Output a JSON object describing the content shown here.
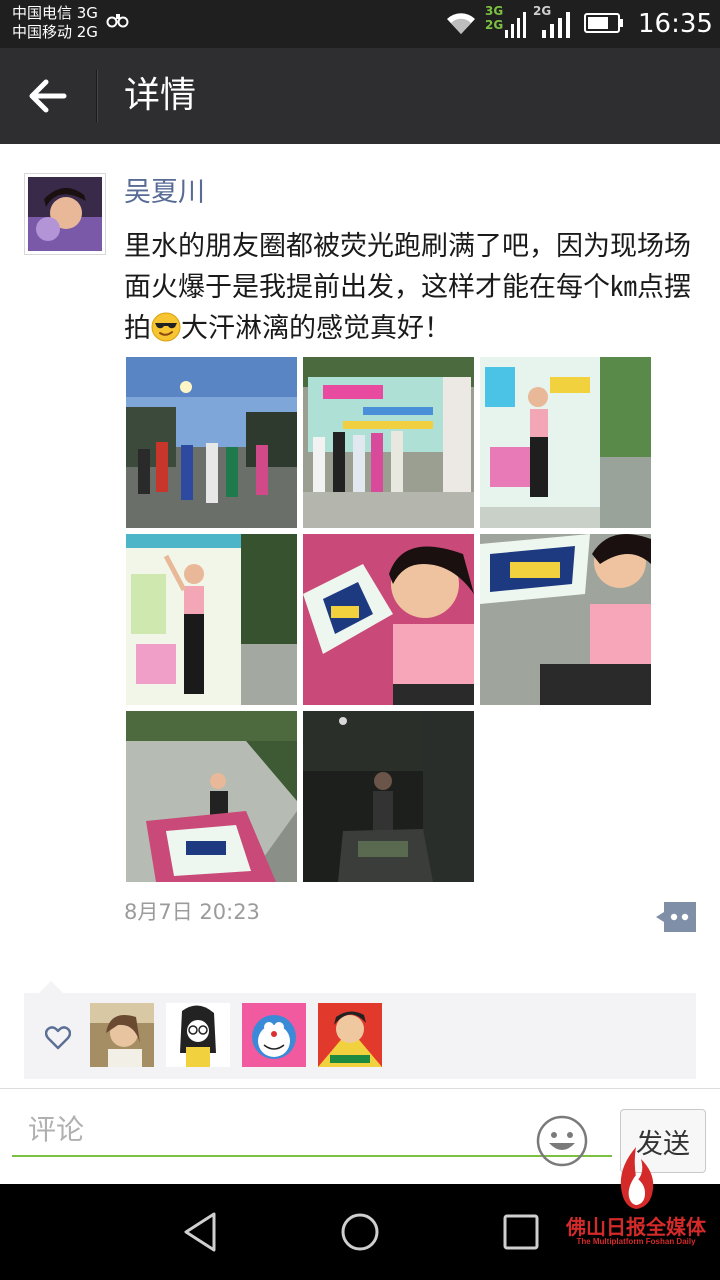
{
  "status_bar": {
    "carrier_1": "中国电信 3G",
    "carrier_2": "中国移动 2G",
    "network_1": "3G",
    "network_1b": "2G",
    "network_2": "2G",
    "time": "16:35",
    "icons": [
      "link-icon",
      "wifi-icon",
      "signal-icon",
      "battery-icon"
    ]
  },
  "title_bar": {
    "back_icon": "arrow-left-icon",
    "title": "详情"
  },
  "post": {
    "author": "吴夏川",
    "text_before_emoji": "里水的朋友圈都被荧光跑刷满了吧，因为现场场面火爆于是我提前出发，这样才能在每个㎞点摆拍",
    "emoji": "sunglasses-face-emoji",
    "text_after_emoji": "大汗淋漓的感觉真好！",
    "photos": [
      "photo-evening-crowd",
      "photo-runners-banner",
      "photo-woman-banner",
      "photo-woman-posing",
      "photo-selfie-km-sign",
      "photo-selfie-km-sign-2",
      "photo-path-km-sign",
      "photo-night-km-sign"
    ],
    "timestamp": "8月7日 20:23",
    "comment_icon": "comment-dots-icon"
  },
  "likes": {
    "icon": "heart-outline-icon",
    "users": [
      "liker-avatar-1",
      "liker-avatar-2",
      "liker-avatar-3",
      "liker-avatar-4"
    ]
  },
  "comment_bar": {
    "placeholder": "评论",
    "emoji_icon": "smiley-icon",
    "send_label": "发送"
  },
  "nav_bar": {
    "icons": [
      "nav-back-triangle-icon",
      "nav-home-circle-icon",
      "nav-recent-square-icon"
    ]
  },
  "watermark": {
    "title": "佛山日报全媒体",
    "subtitle": "The Multiplatform Foshan Daily"
  },
  "colors": {
    "title_bar_bg": "#2e2e31",
    "status_bar_bg": "#1f1f1f",
    "author_name": "#576b95",
    "input_underline": "#7cc142",
    "watermark_red": "#d42a2a"
  }
}
